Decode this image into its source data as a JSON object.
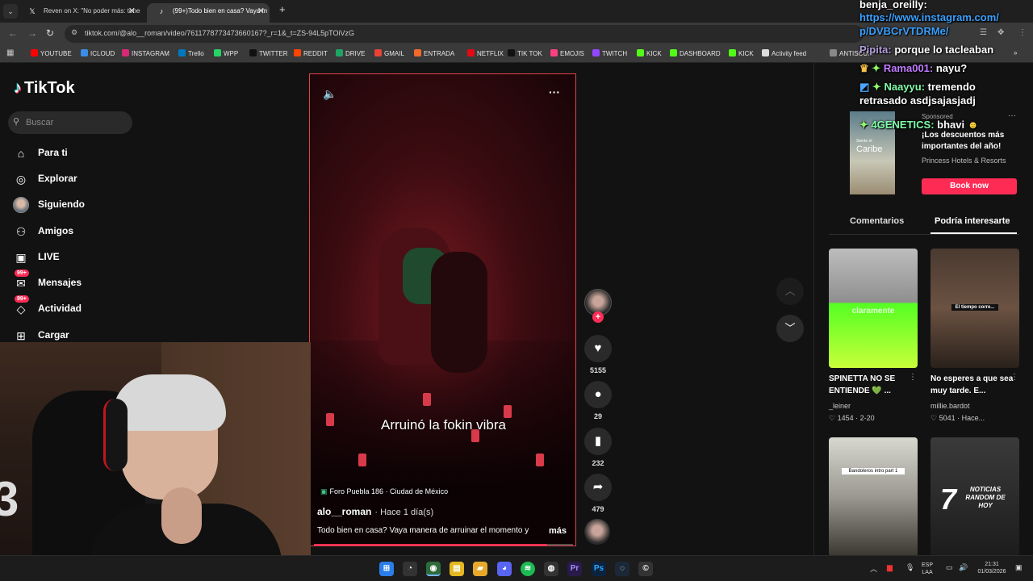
{
  "browser": {
    "tabs": [
      {
        "label": "Reven on X: \"No poder más: tener"
      },
      {
        "label": "(99+)Todo bien en casa? Vaya m"
      }
    ],
    "url": "tiktok.com/@alo__roman/video/7611778773473660167?_r=1&_t=ZS-94L5pTOiVzG",
    "bookmarks": [
      {
        "label": "YOUTUBE",
        "color": "#ff0000"
      },
      {
        "label": "ICLOUD",
        "color": "#3a8ee6"
      },
      {
        "label": "INSTAGRAM",
        "color": "#d62976"
      },
      {
        "label": "Trello",
        "color": "#0079bf"
      },
      {
        "label": "WPP",
        "color": "#25d366"
      },
      {
        "label": "TWITTER",
        "color": "#111111"
      },
      {
        "label": "REDDIT",
        "color": "#ff4500"
      },
      {
        "label": "DRIVE",
        "color": "#1fa463"
      },
      {
        "label": "GMAIL",
        "color": "#ea4335"
      },
      {
        "label": "ENTRADA",
        "color": "#f06a2a"
      },
      {
        "label": "NETFLIX",
        "color": "#e50914"
      },
      {
        "label": "TIK TOK",
        "color": "#111111"
      },
      {
        "label": "EMOJIS",
        "color": "#ff4081"
      },
      {
        "label": "TWITCH",
        "color": "#9146ff"
      },
      {
        "label": "KICK",
        "color": "#53fc18"
      },
      {
        "label": "DASHBOARD",
        "color": "#53fc18"
      },
      {
        "label": "KICK",
        "color": "#53fc18"
      },
      {
        "label": "Activity feed",
        "color": "#dddddd"
      },
      {
        "label": "ANTISCUFF",
        "color": "#888888"
      }
    ]
  },
  "tiktok": {
    "logo": "TikTok",
    "search_placeholder": "Buscar",
    "nav": [
      {
        "label": "Para ti",
        "icon": "home-icon"
      },
      {
        "label": "Explorar",
        "icon": "compass-icon"
      },
      {
        "label": "Siguiendo",
        "icon": "avatar"
      },
      {
        "label": "Amigos",
        "icon": "friends-icon"
      },
      {
        "label": "LIVE",
        "icon": "live-icon"
      },
      {
        "label": "Mensajes",
        "icon": "messages-icon",
        "badge": "99+"
      },
      {
        "label": "Actividad",
        "icon": "activity-icon",
        "badge": "99+"
      },
      {
        "label": "Cargar",
        "icon": "upload-icon"
      }
    ],
    "video": {
      "caption": "Arruinó la fokin vibra",
      "location": "Foro Puebla 186 · Ciudad de México",
      "author": "alo__roman",
      "time": "· Hace 1 día(s)",
      "description": "Todo bien en casa? Vaya manera de arruinar el momento y",
      "more": "más",
      "progress": 0.9
    },
    "actions": {
      "likes": "5155",
      "comments": "29",
      "saves": "232",
      "shares": "479"
    },
    "ad": {
      "image_text_small": "Siente el",
      "image_text": "Caribe",
      "sponsored": "Sponsored",
      "headline": "¡Los descuentos más importantes del año!",
      "brand": "Princess Hotels & Resorts",
      "cta": "Book now"
    },
    "panel_tabs": [
      "Comentarios",
      "Podría interesarte"
    ],
    "cards": [
      {
        "title": "SPINETTA NO SE ENTIENDE 💚 ...",
        "user": "_leiner",
        "stats": "♡ 1454 · 2-20",
        "overlay": "claramente"
      },
      {
        "title": "No esperes a que sea muy tarde. E...",
        "user": "millie.bardot",
        "stats": "♡ 5041 · Hace...",
        "overlay": "El tiempo corre..."
      },
      {
        "overlay": "Bandoleros intro part 1"
      },
      {
        "overlay_num": "7",
        "overlay": "NOTICIAS RANDOM DE HOY"
      }
    ]
  },
  "chat": [
    {
      "name": "benja_oreilly:",
      "text": "",
      "name_color": "#ffffff"
    },
    {
      "name": "",
      "text": "https://www.instagram.com/",
      "text_color": "#3aa0ff"
    },
    {
      "name": "",
      "text": "p/DVBCrVTDRMe/",
      "text_color": "#3aa0ff"
    },
    {
      "name": "Pipita:",
      "text": " porque lo tacleaban",
      "name_color": "#b39ddb"
    },
    {
      "name": "Rama001:",
      "text": " nayu?",
      "name_color": "#c07bff"
    },
    {
      "name": "Naayyu:",
      "text": " tremendo",
      "name_color": "#7fffa8"
    },
    {
      "name": "",
      "text": "retrasado asdjsajasjadj"
    },
    {
      "name": "4GENETICS:",
      "text": " bhavi",
      "name_color": "#7fffa8"
    }
  ],
  "taskbar": {
    "lang_1": "ESP",
    "lang_2": "LAA",
    "time": "21:31",
    "date": "01/03/2026"
  }
}
